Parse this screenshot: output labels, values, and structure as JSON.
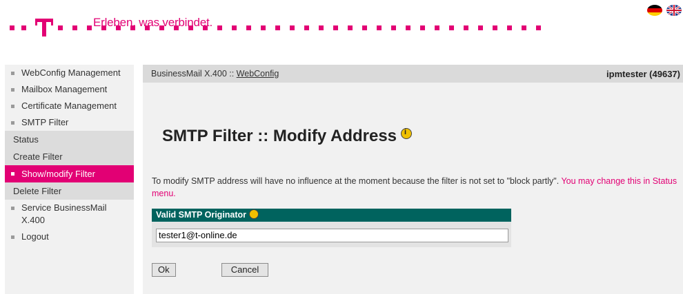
{
  "header": {
    "tagline": "Erleben, was verbindet.",
    "logo_letter": "T",
    "brand_color": "#e20074"
  },
  "flags": [
    "flag-germany-icon",
    "flag-uk-icon"
  ],
  "sidebar": {
    "items": [
      {
        "label": "WebConfig Management"
      },
      {
        "label": "Mailbox Management"
      },
      {
        "label": "Certificate Management"
      },
      {
        "label": "SMTP Filter"
      }
    ],
    "sub_items": [
      {
        "label": "Status"
      },
      {
        "label": "Create Filter"
      },
      {
        "label": "Show/modify Filter"
      },
      {
        "label": "Delete Filter"
      }
    ],
    "after_items": [
      {
        "label": "Service BusinessMail X.400"
      },
      {
        "label": "Logout"
      }
    ]
  },
  "topbar": {
    "crumb_prefix": "BusinessMail X.400 :: ",
    "crumb_link": "WebConfig",
    "user": "ipmtester (49637)"
  },
  "main": {
    "title": "SMTP Filter :: Modify Address",
    "message": "To modify SMTP address will have no influence at the moment because the filter is not set to \"block partly\". ",
    "message_link": "You may change this in Status menu.",
    "field_label": "Valid SMTP Originator",
    "field_value": "tester1@t-online.de",
    "ok_label": "Ok",
    "cancel_label": "Cancel"
  }
}
